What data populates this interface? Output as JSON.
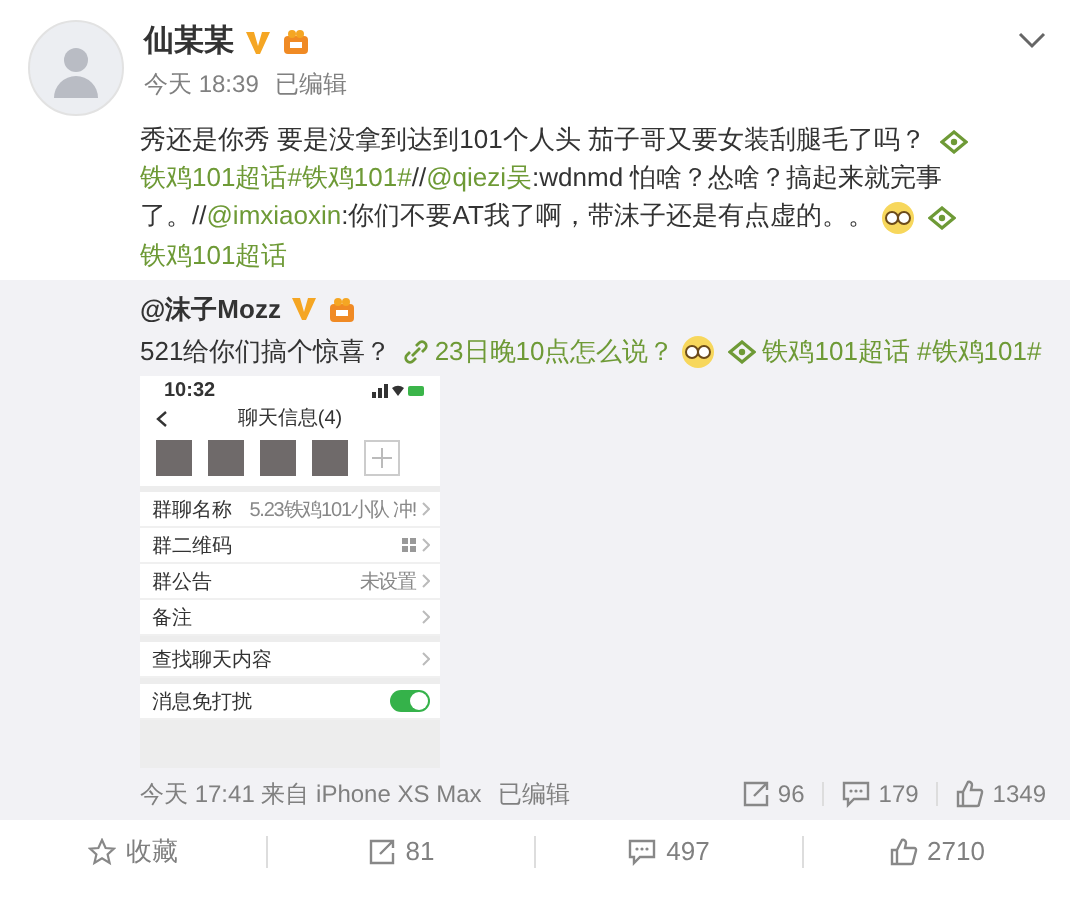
{
  "post": {
    "author": "仙某某",
    "verified": true,
    "time": "今天 18:39",
    "edited": "已编辑",
    "segments": [
      {
        "kind": "plain",
        "text": "秀还是你秀 要是没拿到达到101个人头 茄子哥又要女装刮腿毛了吗？ "
      },
      {
        "kind": "topic",
        "text": "铁鸡101超话"
      },
      {
        "kind": "hashtag",
        "text": "#铁鸡101#"
      },
      {
        "kind": "plain",
        "text": "//"
      },
      {
        "kind": "mention",
        "text": "@qiezi吴"
      },
      {
        "kind": "plain",
        "text": ":wdnmd 怕啥？怂啥？搞起来就完事了。//"
      },
      {
        "kind": "mention",
        "text": "@imxiaoxin"
      },
      {
        "kind": "plain",
        "text": ":你们不要AT我了啊，带沫子还是有点虚的。。"
      },
      {
        "kind": "emoji"
      },
      {
        "kind": "topic",
        "text": "铁鸡101超话"
      }
    ]
  },
  "repost": {
    "author": "@沫子Mozz",
    "verified": true,
    "segments": [
      {
        "kind": "plain",
        "text": "521给你们搞个惊喜？ "
      },
      {
        "kind": "weblink",
        "text": "23日晚10点怎么说？"
      },
      {
        "kind": "emoji"
      },
      {
        "kind": "topic",
        "text": "铁鸡101超话"
      },
      {
        "kind": "hashtag",
        "text": " #铁鸡101#"
      }
    ],
    "screenshot": {
      "clock": "10:32",
      "title": "聊天信息(4)",
      "groups": [
        [
          {
            "label": "群聊名称",
            "value": "5.23铁鸡101小队 冲!"
          },
          {
            "label": "群二维码",
            "kind": "qr"
          },
          {
            "label": "群公告",
            "value": "未设置"
          },
          {
            "label": "备注"
          }
        ],
        [
          {
            "label": "查找聊天内容"
          }
        ],
        [
          {
            "label": "消息免打扰",
            "kind": "toggle",
            "on": true
          }
        ]
      ]
    },
    "footer": {
      "info": "今天 17:41 来自 iPhone XS Max",
      "edited": "已编辑",
      "reposts": "96",
      "comments": "179",
      "likes": "1349"
    }
  },
  "actions": [
    {
      "kind": "favorite",
      "text": "收藏"
    },
    {
      "kind": "repost",
      "text": "81"
    },
    {
      "kind": "comment",
      "text": "497"
    },
    {
      "kind": "like",
      "text": "2710"
    }
  ]
}
